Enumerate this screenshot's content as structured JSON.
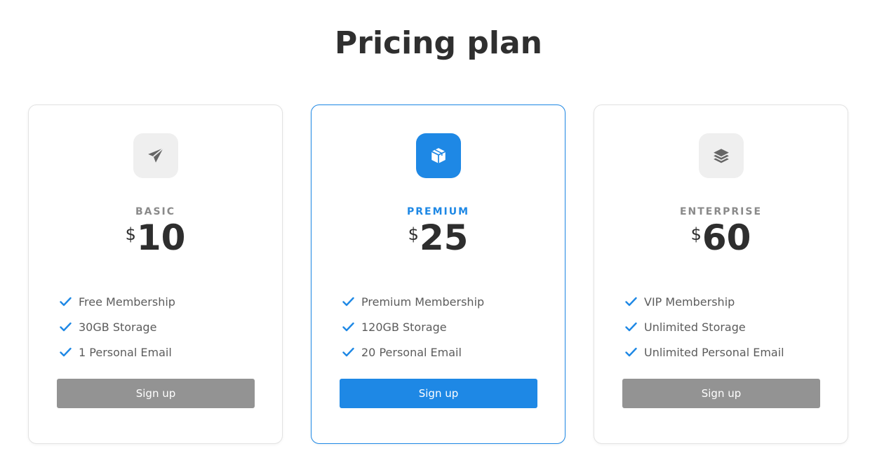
{
  "page": {
    "title": "Pricing plan"
  },
  "colors": {
    "accent": "#1e88e5",
    "muted_button": "#939393",
    "icon_bg": "#efefef",
    "check": "#1e88e5"
  },
  "plans": [
    {
      "icon": "paper-plane-icon",
      "name": "BASIC",
      "currency": "$",
      "price": "10",
      "features": [
        "Free Membership",
        "30GB Storage",
        "1 Personal Email"
      ],
      "button": "Sign up",
      "highlighted": false
    },
    {
      "icon": "box-icon",
      "name": "PREMIUM",
      "currency": "$",
      "price": "25",
      "features": [
        "Premium Membership",
        "120GB Storage",
        "20 Personal Email"
      ],
      "button": "Sign up",
      "highlighted": true
    },
    {
      "icon": "layers-icon",
      "name": "ENTERPRISE",
      "currency": "$",
      "price": "60",
      "features": [
        "VIP Membership",
        "Unlimited Storage",
        "Unlimited Personal Email"
      ],
      "button": "Sign up",
      "highlighted": false
    }
  ]
}
